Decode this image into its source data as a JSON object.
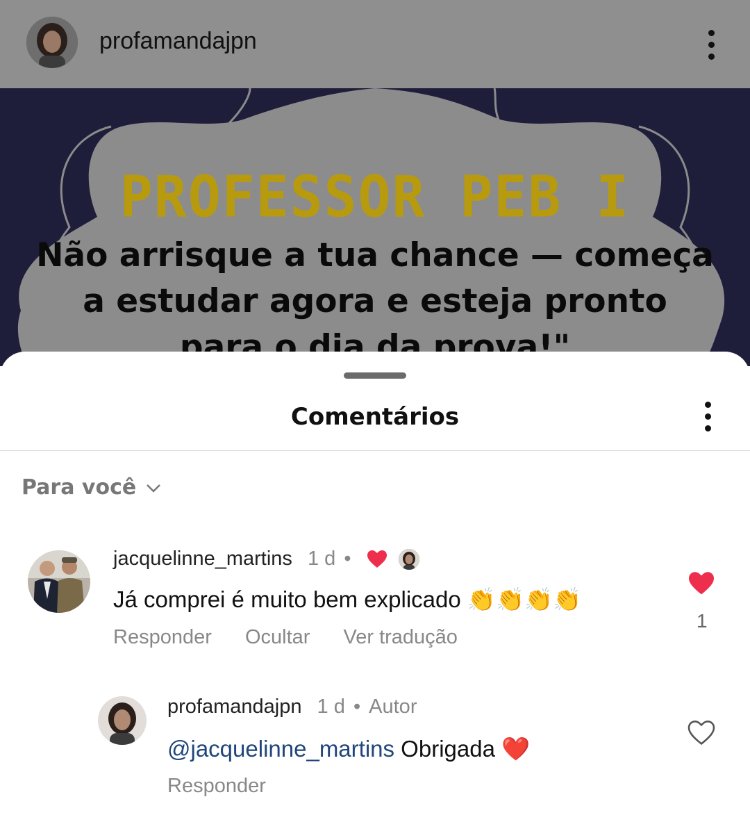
{
  "post": {
    "username": "profamandajpn",
    "image_title": "PROFESSOR PEB I",
    "image_text_line1": "Não arrisque a tua chance — começa",
    "image_text_line2": "a estudar agora e esteja pronto",
    "image_text_line3": "para o dia da prova!\""
  },
  "sheet": {
    "title": "Comentários",
    "filter_label": "Para você"
  },
  "comments": [
    {
      "username": "jacquelinne_martins",
      "time": "1 d",
      "text": "Já comprei é muito bem explicado 👏👏👏👏",
      "actions": [
        "Responder",
        "Ocultar",
        "Ver tradução"
      ],
      "likes": "1"
    },
    {
      "username": "profamandajpn",
      "time": "1 d",
      "badge": "Autor",
      "mention": "@jacquelinne_martins",
      "text": " Obrigada ❤️",
      "actions": [
        "Responder"
      ]
    }
  ],
  "colors": {
    "heart_red": "#ee2e4d",
    "mention_blue": "#20467a",
    "title_yellow": "#b89a0e",
    "dim_gray": "#8f8f8f"
  }
}
